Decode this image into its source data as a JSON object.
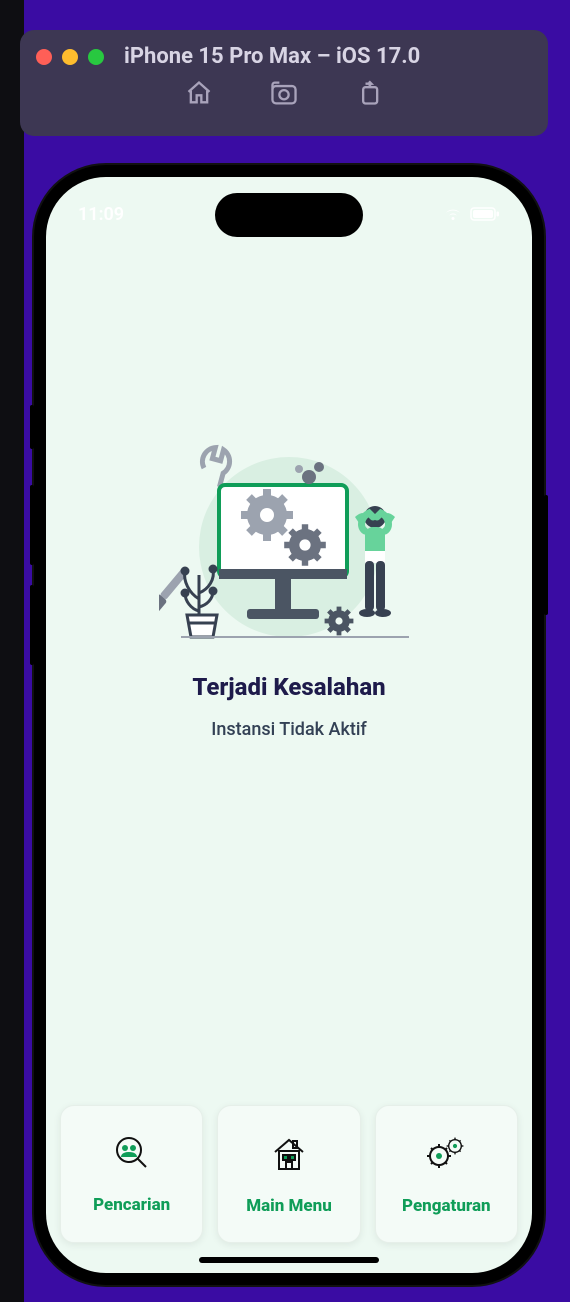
{
  "simulator": {
    "title": "iPhone 15 Pro Max – iOS 17.0"
  },
  "status": {
    "time": "11:09"
  },
  "error": {
    "title": "Terjadi Kesalahan",
    "subtitle": "Instansi Tidak Aktif"
  },
  "nav": {
    "items": [
      {
        "label": "Pencarian"
      },
      {
        "label": "Main Menu"
      },
      {
        "label": "Pengaturan"
      }
    ]
  },
  "colors": {
    "accent_green": "#0f9d58",
    "screen_bg": "#edf9f2",
    "window_bg": "#3d3753",
    "page_bg": "#3a0ca3"
  }
}
